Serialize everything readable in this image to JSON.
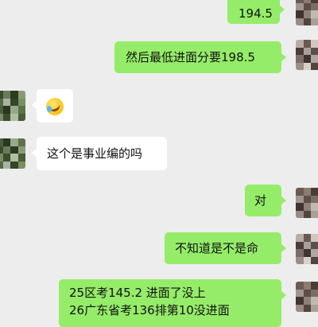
{
  "chat": {
    "messages": [
      {
        "id": "m1",
        "direction": "out",
        "text": "194.5"
      },
      {
        "id": "m2",
        "direction": "out",
        "text": "然后最低进面分要198.5"
      },
      {
        "id": "m3",
        "direction": "in",
        "emoji": "laughing-crying-emoji"
      },
      {
        "id": "m4",
        "direction": "in",
        "text": "这个是事业编的吗"
      },
      {
        "id": "m5",
        "direction": "out",
        "text": "对"
      },
      {
        "id": "m6",
        "direction": "out",
        "text": "不知道是不是命"
      },
      {
        "id": "m7",
        "direction": "out",
        "line1": "25区考145.2 进面了没上",
        "line2": "26广东省考136排第10没进面"
      }
    ]
  },
  "colors": {
    "background": "#ededed",
    "outgoing_bubble": "#95ec69",
    "incoming_bubble": "#ffffff"
  }
}
